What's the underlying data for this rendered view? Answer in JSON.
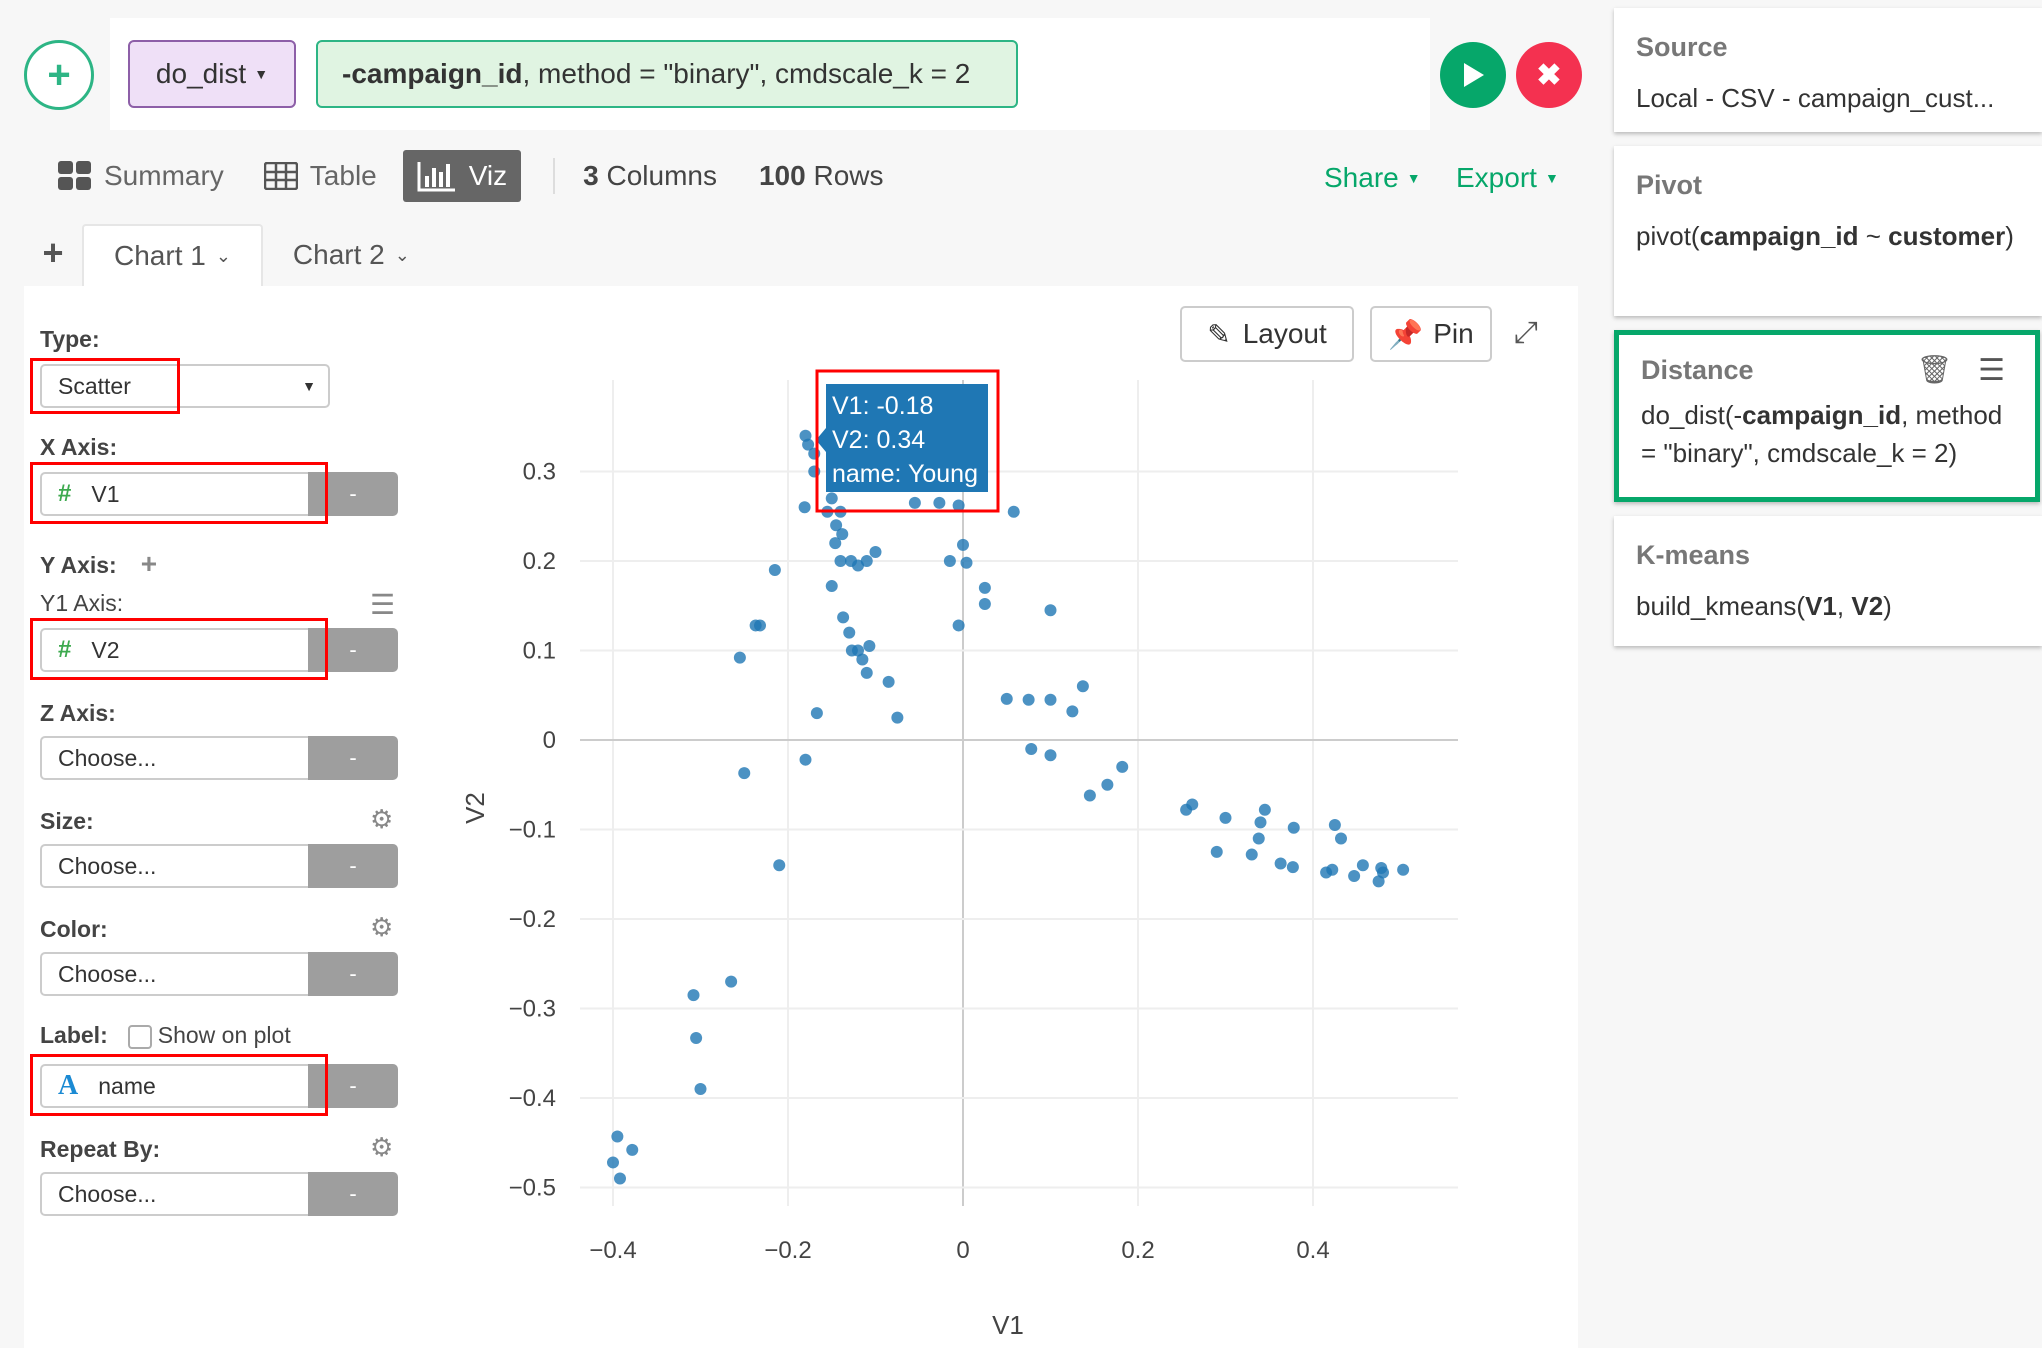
{
  "command": {
    "function": "do_dist",
    "args_bold": "-campaign_id",
    "args_rest": ", method = \"binary\", cmdscale_k = 2"
  },
  "view_tabs": [
    {
      "label": "Summary",
      "icon": "grid-icon",
      "active": false
    },
    {
      "label": "Table",
      "icon": "table-icon",
      "active": false
    },
    {
      "label": "Viz",
      "icon": "bar-chart-icon",
      "active": true
    }
  ],
  "stats": {
    "columns_count": "3",
    "columns_label": "Columns",
    "rows_count": "100",
    "rows_label": "Rows"
  },
  "actions": {
    "share": "Share",
    "export": "Export"
  },
  "chart_tabs": [
    {
      "label": "Chart 1",
      "active": true
    },
    {
      "label": "Chart 2",
      "active": false
    }
  ],
  "config": {
    "type_label": "Type:",
    "type_value": "Scatter",
    "x_label": "X Axis:",
    "x_value": "V1",
    "y_label": "Y Axis:",
    "y1_label": "Y1 Axis:",
    "y_value": "V2",
    "z_label": "Z Axis:",
    "z_value": "Choose...",
    "size_label": "Size:",
    "size_value": "Choose...",
    "color_label": "Color:",
    "color_value": "Choose...",
    "label_label": "Label:",
    "show_on_plot": "Show on plot",
    "label_value": "name",
    "repeat_label": "Repeat By:",
    "repeat_value": "Choose...",
    "minus": "-"
  },
  "chart_buttons": {
    "layout": "Layout",
    "pin": "Pin"
  },
  "tooltip": {
    "line1": "V1: -0.18",
    "line2": "V2: 0.34",
    "line3": "name: Young"
  },
  "chart_data": {
    "type": "scatter",
    "xlabel": "V1",
    "ylabel": "V2",
    "xlim": [
      -0.44,
      0.56
    ],
    "ylim": [
      -0.53,
      0.36
    ],
    "xticks": [
      -0.4,
      -0.2,
      0,
      0.2,
      0.4
    ],
    "xtick_labels": [
      "−0.4",
      "−0.2",
      "0",
      "0.2",
      "0.4"
    ],
    "yticks": [
      0.3,
      0.2,
      0.1,
      0,
      -0.1,
      -0.2,
      -0.3,
      -0.4,
      -0.5
    ],
    "ytick_labels": [
      "0.3",
      "0.2",
      "0.1",
      "0",
      "−0.1",
      "−0.2",
      "−0.3",
      "−0.4",
      "−0.5"
    ],
    "grid": true,
    "marker_color": "#1f77b4",
    "points": [
      [
        -0.18,
        0.34
      ],
      [
        -0.177,
        0.33
      ],
      [
        -0.17,
        0.32
      ],
      [
        -0.17,
        0.3
      ],
      [
        -0.181,
        0.26
      ],
      [
        -0.15,
        0.27
      ],
      [
        -0.155,
        0.255
      ],
      [
        -0.14,
        0.255
      ],
      [
        -0.145,
        0.24
      ],
      [
        -0.138,
        0.23
      ],
      [
        -0.146,
        0.22
      ],
      [
        -0.14,
        0.2
      ],
      [
        -0.128,
        0.2
      ],
      [
        -0.12,
        0.195
      ],
      [
        -0.11,
        0.2
      ],
      [
        -0.1,
        0.21
      ],
      [
        -0.215,
        0.19
      ],
      [
        -0.232,
        0.128
      ],
      [
        -0.237,
        0.128
      ],
      [
        -0.255,
        0.092
      ],
      [
        -0.15,
        0.172
      ],
      [
        -0.137,
        0.137
      ],
      [
        -0.13,
        0.12
      ],
      [
        -0.12,
        0.1
      ],
      [
        -0.127,
        0.1
      ],
      [
        -0.107,
        0.105
      ],
      [
        -0.115,
        0.09
      ],
      [
        -0.11,
        0.075
      ],
      [
        -0.085,
        0.065
      ],
      [
        -0.075,
        0.025
      ],
      [
        -0.167,
        0.03
      ],
      [
        -0.18,
        -0.022
      ],
      [
        -0.25,
        -0.037
      ],
      [
        -0.21,
        -0.14
      ],
      [
        -0.055,
        0.265
      ],
      [
        -0.027,
        0.265
      ],
      [
        -0.005,
        0.262
      ],
      [
        0.058,
        0.255
      ],
      [
        -0.015,
        0.2
      ],
      [
        0.0,
        0.218
      ],
      [
        0.004,
        0.198
      ],
      [
        0.025,
        0.17
      ],
      [
        0.025,
        0.152
      ],
      [
        -0.005,
        0.128
      ],
      [
        0.1,
        0.145
      ],
      [
        0.05,
        0.046
      ],
      [
        0.075,
        0.045
      ],
      [
        0.1,
        0.045
      ],
      [
        0.137,
        0.06
      ],
      [
        0.125,
        0.032
      ],
      [
        0.078,
        -0.01
      ],
      [
        0.1,
        -0.017
      ],
      [
        0.182,
        -0.03
      ],
      [
        0.165,
        -0.05
      ],
      [
        0.145,
        -0.062
      ],
      [
        0.255,
        -0.078
      ],
      [
        0.262,
        -0.072
      ],
      [
        0.3,
        -0.087
      ],
      [
        0.34,
        -0.092
      ],
      [
        0.345,
        -0.078
      ],
      [
        0.378,
        -0.098
      ],
      [
        0.338,
        -0.11
      ],
      [
        0.425,
        -0.095
      ],
      [
        0.432,
        -0.11
      ],
      [
        0.29,
        -0.125
      ],
      [
        0.33,
        -0.128
      ],
      [
        0.363,
        -0.138
      ],
      [
        0.377,
        -0.142
      ],
      [
        0.415,
        -0.148
      ],
      [
        0.422,
        -0.145
      ],
      [
        0.447,
        -0.152
      ],
      [
        0.457,
        -0.14
      ],
      [
        0.478,
        -0.143
      ],
      [
        0.48,
        -0.148
      ],
      [
        0.475,
        -0.158
      ],
      [
        0.503,
        -0.145
      ],
      [
        -0.308,
        -0.285
      ],
      [
        -0.265,
        -0.27
      ],
      [
        -0.305,
        -0.333
      ],
      [
        -0.3,
        -0.39
      ],
      [
        -0.395,
        -0.443
      ],
      [
        -0.378,
        -0.458
      ],
      [
        -0.4,
        -0.472
      ],
      [
        -0.392,
        -0.49
      ]
    ],
    "tooltip_point": {
      "V1": -0.18,
      "V2": 0.34,
      "name": "Young"
    }
  },
  "steps": [
    {
      "title": "Source",
      "body": "Local - CSV - campaign_cust..."
    },
    {
      "title": "Pivot",
      "body_parts": [
        "pivot(",
        "campaign_id",
        " ~ ",
        "customer",
        ")"
      ]
    },
    {
      "title": "Distance",
      "body_parts": [
        "do_dist(-",
        "campaign_id",
        ", method = \"binary\", cmdscale_k = 2)"
      ],
      "selected": true
    },
    {
      "title": "K-means",
      "body_parts": [
        "build_kmeans(",
        "V1",
        ", ",
        "V2",
        ")"
      ]
    }
  ]
}
